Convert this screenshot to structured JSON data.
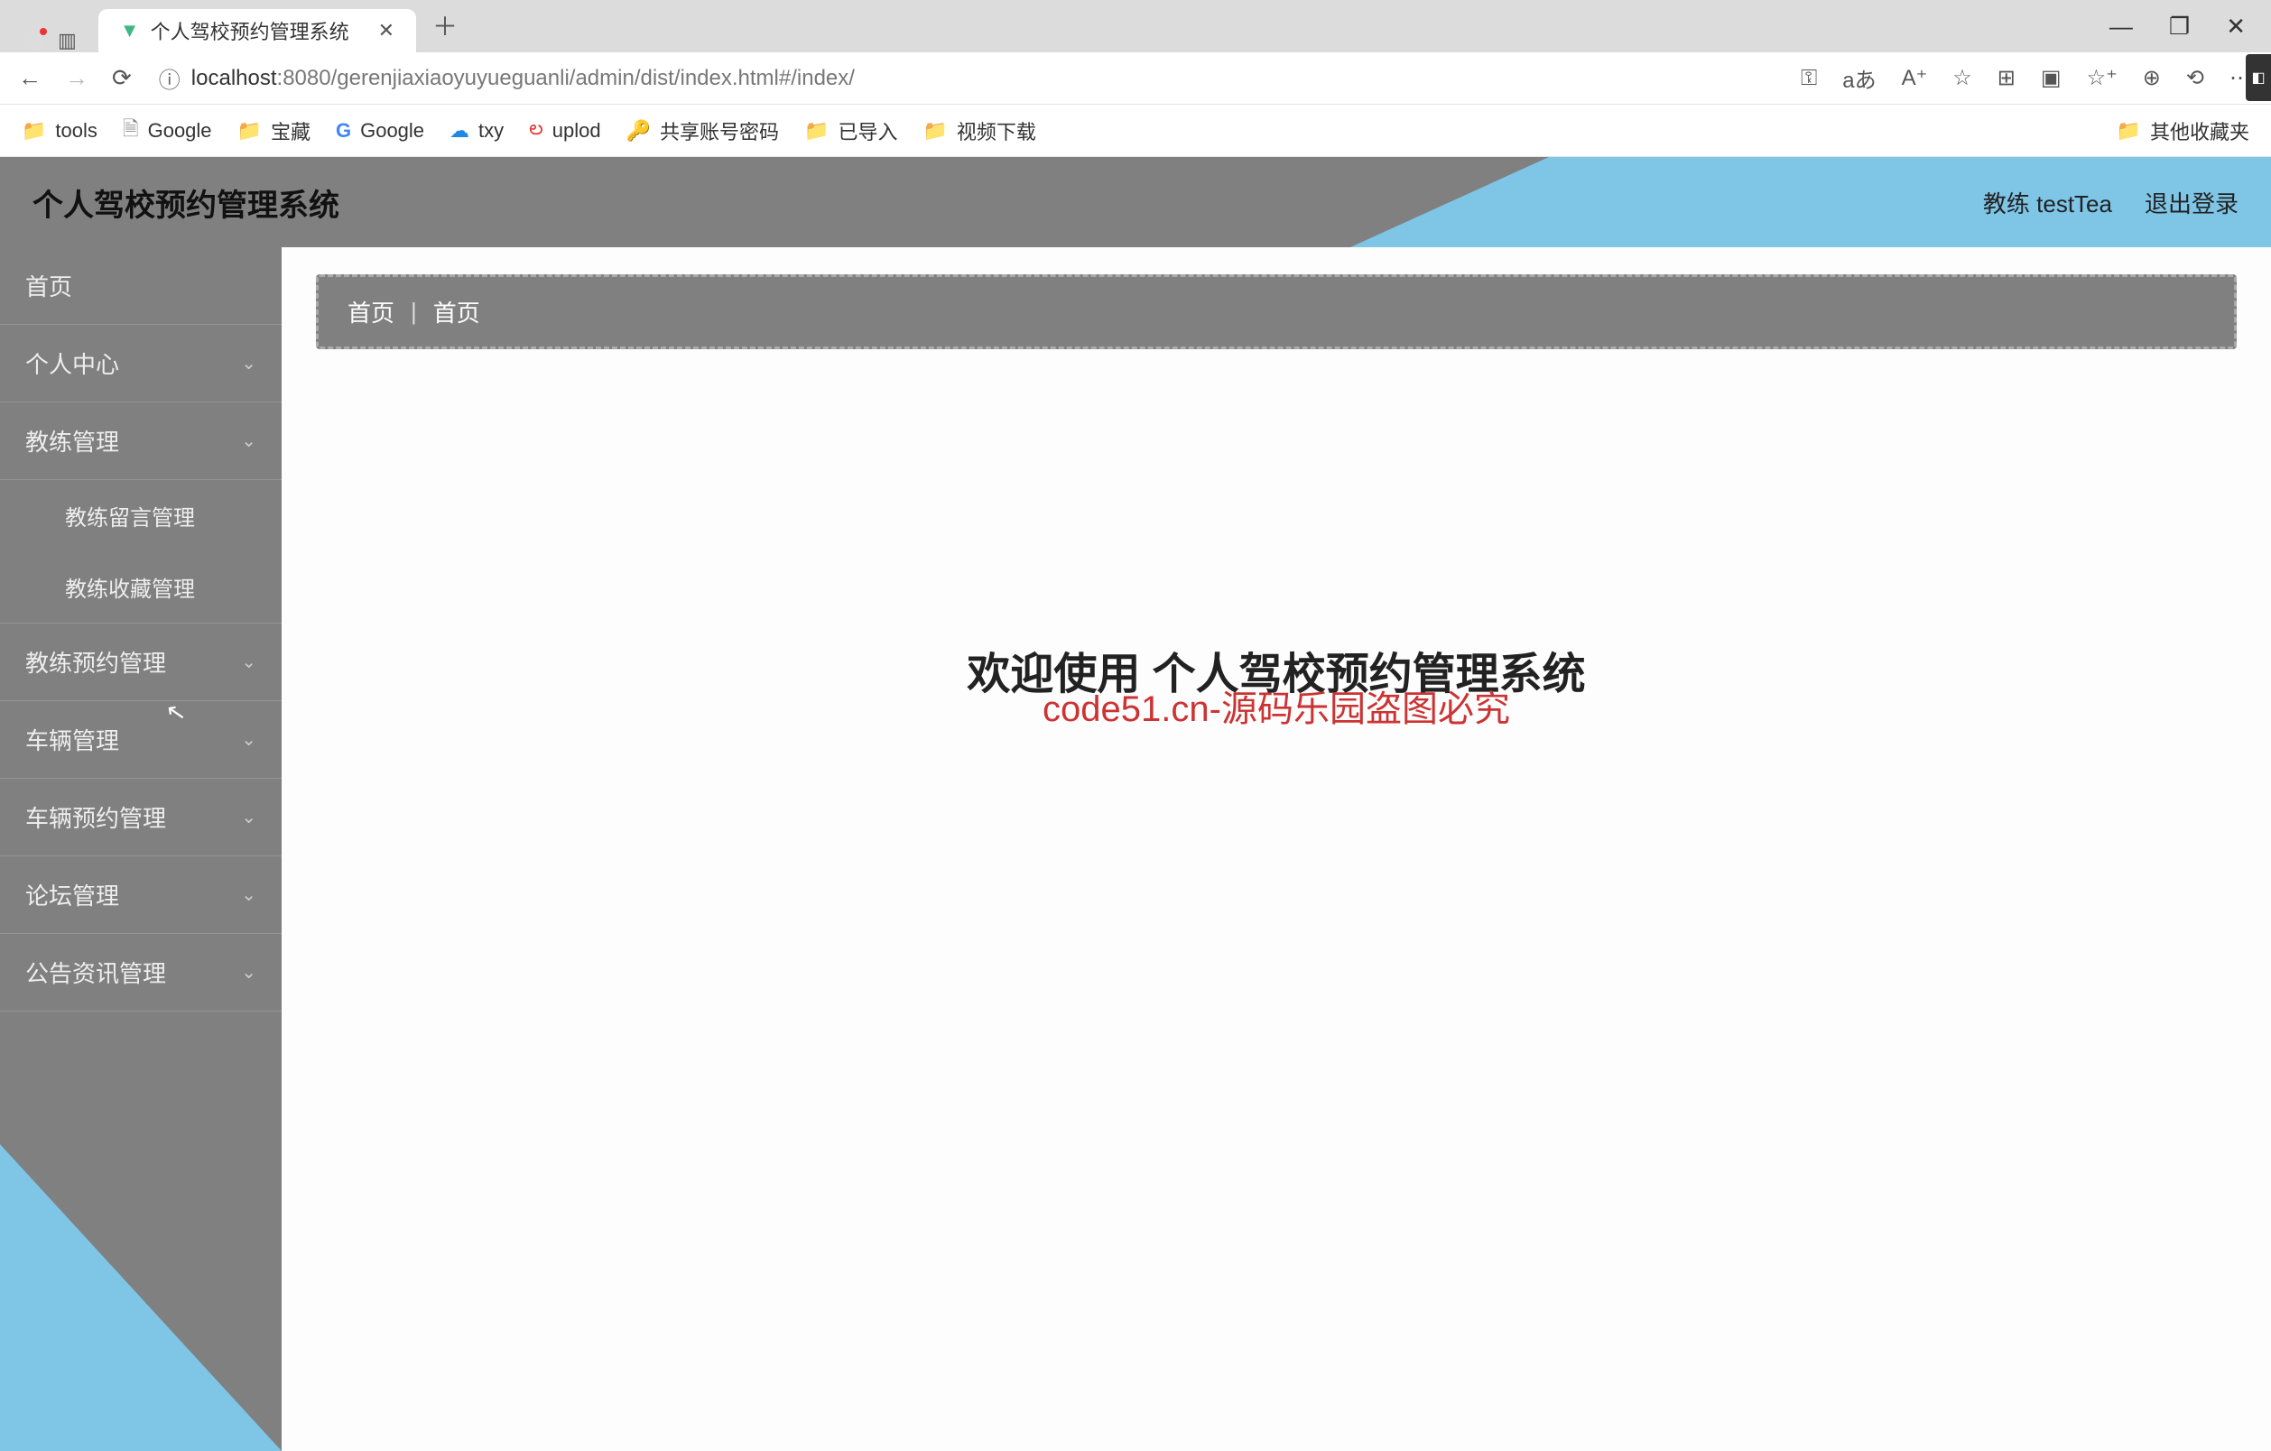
{
  "watermark": "code51.cn",
  "browser": {
    "tab_title": "个人驾校预约管理系统",
    "url_host": "localhost",
    "url_port": ":8080",
    "url_path": "/gerenjiaxiaoyuyueguanli/admin/dist/index.html#/index/",
    "bookmarks": {
      "tools": "tools",
      "google1": "Google",
      "baozang": "宝藏",
      "google2": "Google",
      "txy": "txy",
      "uplod": "uplod",
      "shared": "共享账号密码",
      "imported": "已导入",
      "video": "视频下载",
      "other": "其他收藏夹"
    }
  },
  "app": {
    "title": "个人驾校预约管理系统",
    "role_label": "教练 testTea",
    "logout": "退出登录"
  },
  "sidebar": {
    "home": "首页",
    "personal": "个人中心",
    "coach_mgmt": "教练管理",
    "coach_msg": "教练留言管理",
    "coach_fav": "教练收藏管理",
    "coach_booking": "教练预约管理",
    "vehicle_mgmt": "车辆管理",
    "vehicle_booking": "车辆预约管理",
    "forum": "论坛管理",
    "notice": "公告资讯管理"
  },
  "breadcrumb": {
    "a": "首页",
    "b": "首页"
  },
  "main": {
    "welcome": "欢迎使用 个人驾校预约管理系统",
    "stamp": "code51.cn-源码乐园盗图必究"
  }
}
